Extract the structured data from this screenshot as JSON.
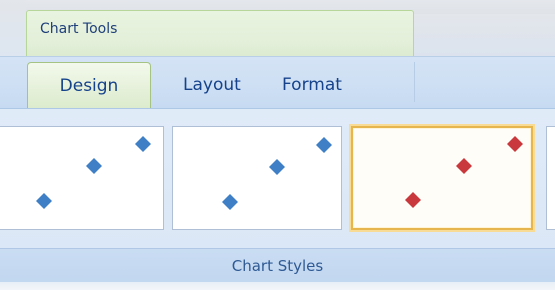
{
  "contextual_header": {
    "label": "Chart Tools"
  },
  "tabs": [
    {
      "label": "Design",
      "selected": true
    },
    {
      "label": "Layout",
      "selected": false
    },
    {
      "label": "Format",
      "selected": false
    }
  ],
  "gallery": {
    "group_label": "Chart Styles",
    "thumbnails": [
      {
        "name": "style-1",
        "marker_color": "#3f7fc6",
        "selected": false,
        "partially_visible": true
      },
      {
        "name": "style-2",
        "marker_color": "#3f7fc6",
        "selected": false,
        "partially_visible": false
      },
      {
        "name": "style-3",
        "marker_color": "#c8383c",
        "selected": true,
        "partially_visible": false
      }
    ]
  },
  "colors": {
    "contextual_tab_tint": "#e5f0d9",
    "selection_highlight": "#e6b54e",
    "ribbon_text": "#15428b"
  }
}
